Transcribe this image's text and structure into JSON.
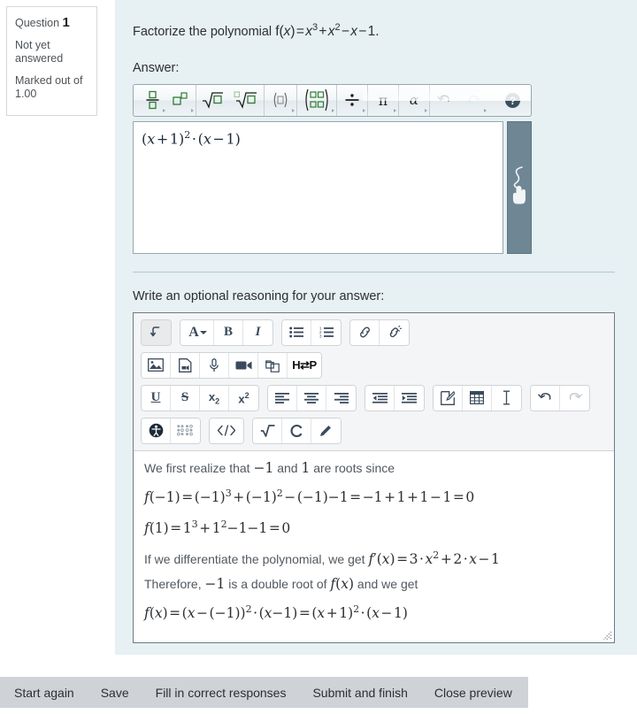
{
  "question_info": {
    "label": "Question",
    "number": "1",
    "state": "Not yet answered",
    "grade": "Marked out of 1.00"
  },
  "main": {
    "question_text": "Factorize the polynomial f(x) = x³ + x² − x − 1.",
    "answer_label": "Answer:",
    "reasoning_label": "Write an optional reasoning for your answer:"
  },
  "math_editor": {
    "answer_value": "(x + 1)² · (x − 1)",
    "toolbar": [
      {
        "name": "fraction",
        "title": "Fraction",
        "has_caret": true
      },
      {
        "name": "superscript",
        "title": "Superscript",
        "has_caret": true
      },
      {
        "name": "square-root",
        "title": "Square root",
        "has_caret": false
      },
      {
        "name": "nth-root",
        "title": "Nth root",
        "has_caret": false
      },
      {
        "name": "parenthesis",
        "title": "Parenthesis",
        "has_caret": true
      },
      {
        "name": "matrix",
        "title": "Matrix",
        "has_caret": true
      },
      {
        "name": "division",
        "title": "Division",
        "has_caret": true
      },
      {
        "name": "pi-symbol",
        "title": "Greek symbols",
        "has_caret": true
      },
      {
        "name": "alpha-symbol",
        "title": "Greek letters",
        "has_caret": true
      },
      {
        "name": "undo",
        "title": "Undo",
        "has_caret": false
      },
      {
        "name": "redo",
        "title": "Redo",
        "has_caret": true
      },
      {
        "name": "help",
        "title": "Help",
        "has_caret": false
      }
    ],
    "handwriting_panel": "handwriting-input"
  },
  "atto_editor": {
    "toolbar_rows": [
      [
        {
          "group": "collapse",
          "buttons": [
            "expand-toolbar"
          ]
        },
        {
          "group": "style1",
          "buttons": [
            "font-style",
            "bold",
            "italic"
          ]
        },
        {
          "group": "list",
          "buttons": [
            "unordered-list",
            "ordered-list"
          ]
        },
        {
          "group": "links",
          "buttons": [
            "link",
            "unlink"
          ]
        }
      ],
      [
        {
          "group": "files",
          "buttons": [
            "image",
            "media",
            "record-audio",
            "record-video",
            "manage-files",
            "h5p"
          ]
        }
      ],
      [
        {
          "group": "style2",
          "buttons": [
            "underline",
            "strikethrough",
            "subscript",
            "superscript"
          ]
        },
        {
          "group": "align",
          "buttons": [
            "align-left",
            "align-center",
            "align-right"
          ]
        },
        {
          "group": "indent",
          "buttons": [
            "outdent",
            "indent"
          ]
        },
        {
          "group": "insert",
          "buttons": [
            "equation",
            "table",
            "clear-formatting"
          ]
        },
        {
          "group": "undo",
          "buttons": [
            "undo",
            "redo"
          ]
        }
      ],
      [
        {
          "group": "accessibility",
          "buttons": [
            "accessibility-checker",
            "screenreader-helper"
          ]
        },
        {
          "group": "html",
          "buttons": [
            "html-source"
          ]
        },
        {
          "group": "math",
          "buttons": [
            "math-equation",
            "chemistry-equation",
            "handwriting"
          ]
        }
      ]
    ],
    "content": [
      {
        "type": "text",
        "value": "We first realize that −1 and 1 are roots since"
      },
      {
        "type": "math",
        "value": "f(−1) = (−1)³ + (−1)² − (−1) − 1 = −1 + 1 + 1 − 1 = 0"
      },
      {
        "type": "math",
        "value": "f(1) = 1³ + 1² − 1 − 1 = 0"
      },
      {
        "type": "mixed",
        "prefix": "If we differentiate the polynomial, we get ",
        "math": "f′(x) = 3 · x² + 2 · x − 1",
        "suffix": ""
      },
      {
        "type": "mixed",
        "prefix": "Therefore, ",
        "math": "−1",
        "mid": " is a double root of ",
        "math2": "f(x)",
        "suffix": " and we get"
      },
      {
        "type": "math",
        "value": "f(x) = (x − (−1))² · (x − 1) = (x + 1)² · (x − 1)"
      }
    ]
  },
  "button_bar": {
    "buttons": [
      {
        "name": "start-again",
        "label": "Start again"
      },
      {
        "name": "save",
        "label": "Save"
      },
      {
        "name": "fill-in-correct-responses",
        "label": "Fill in correct responses"
      },
      {
        "name": "submit-and-finish",
        "label": "Submit and finish"
      },
      {
        "name": "close-preview",
        "label": "Close preview"
      }
    ]
  },
  "colors": {
    "panel_bg": "#e7f0f2",
    "divider": "#a9ccd5",
    "handwriting_panel": "#6f8694",
    "button_bar_bg": "#cfd3d8",
    "math_green": "#2e7d32",
    "atto_icon": "#3a4a5c"
  }
}
